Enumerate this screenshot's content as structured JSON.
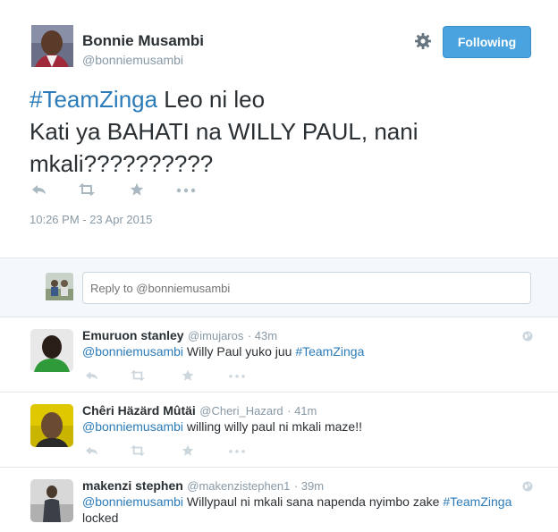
{
  "tweet": {
    "author_name": "Bonnie Musambi",
    "author_handle": "@bonniemusambi",
    "follow_label": "Following",
    "hashtag": "#TeamZinga",
    "line1_rest": " Leo ni leo",
    "line2": "Kati ya BAHATI na WILLY PAUL, nani mkali??????????",
    "timestamp": "10:26 PM - 23 Apr 2015"
  },
  "reply_box": {
    "placeholder": "Reply to @bonniemusambi"
  },
  "replies": [
    {
      "name": "Emuruon stanley",
      "handle": "@imujaros",
      "time": "· 43m",
      "mention": "@bonniemusambi",
      "text": " Willy Paul yuko juu ",
      "hashtag": "#TeamZinga",
      "text2": ""
    },
    {
      "name": "Chêri Häzärd Mûtäi",
      "handle": "@Cheri_Hazard",
      "time": "· 41m",
      "mention": "@bonniemusambi",
      "text": " willing willy paul ni mkali maze!!",
      "hashtag": "",
      "text2": ""
    },
    {
      "name": "makenzi stephen",
      "handle": "@makenzistephen1",
      "time": "· 39m",
      "mention": "@bonniemusambi",
      "text": " Willypaul ni mkali sana napenda nyimbo zake ",
      "hashtag": "#TeamZinga",
      "text2": "locked"
    }
  ],
  "colors": {
    "link": "#2b7bb9",
    "follow_button": "#4aa3df",
    "muted": "#8899a6",
    "action_icons": "#aab8c2"
  },
  "icons": [
    "reply-icon",
    "retweet-icon",
    "favorite-icon",
    "more-icon",
    "gear-icon",
    "globe-icon"
  ]
}
